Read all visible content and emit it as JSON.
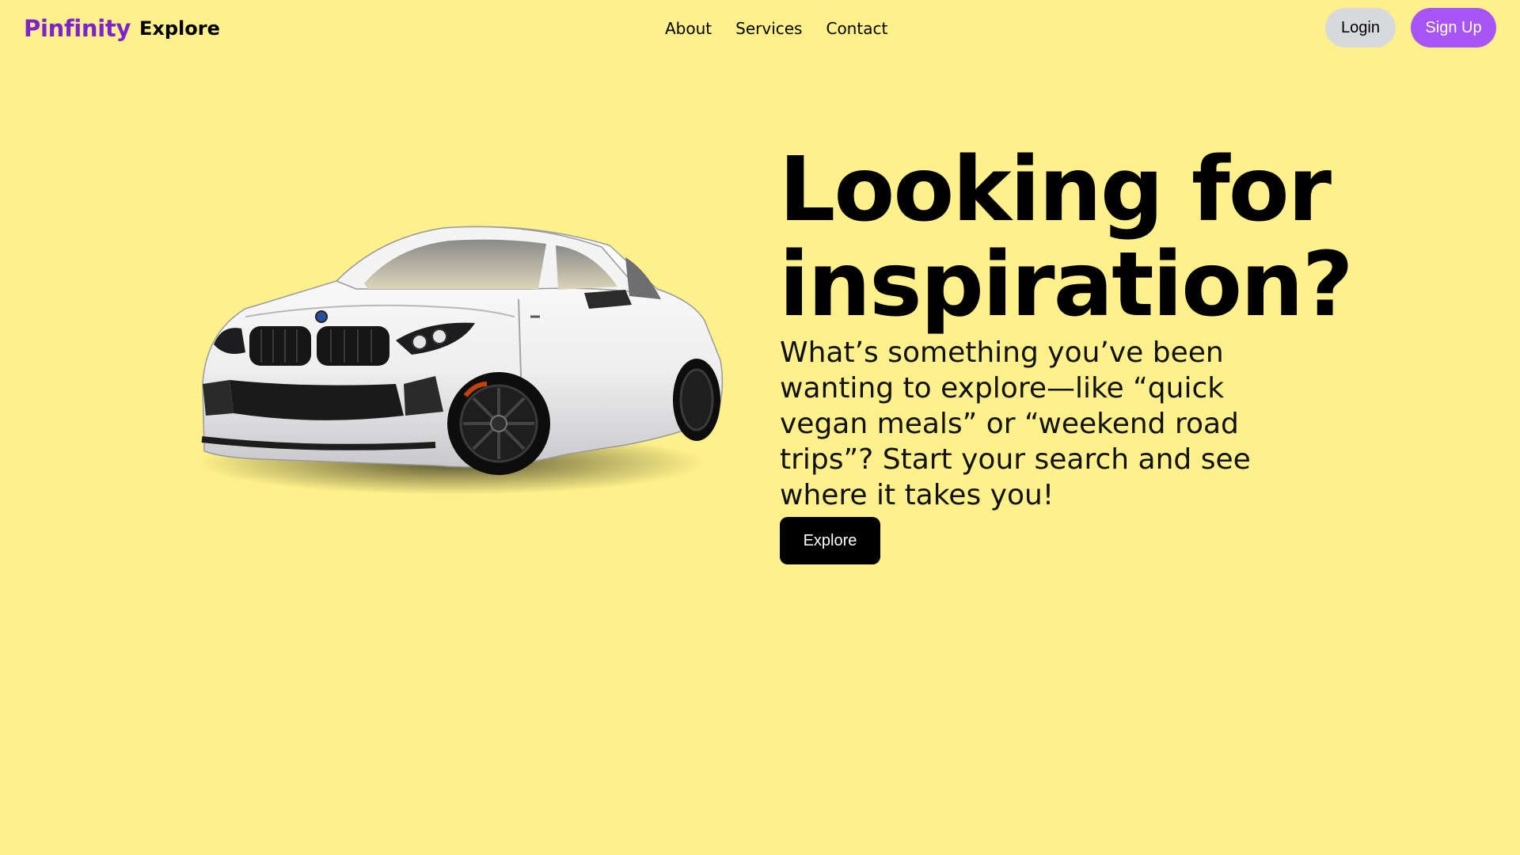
{
  "header": {
    "brand": "Pinfinity",
    "explore": "Explore",
    "nav": [
      "About",
      "Services",
      "Contact"
    ],
    "login_label": "Login",
    "signup_label": "Sign Up"
  },
  "hero": {
    "image": "white sports coupe car photo",
    "title_line1": "Looking for",
    "title_line2": "inspiration?",
    "subtitle": "What’s something you’ve been wanting to explore—like “quick vegan meals” or “weekend road trips”? Start your search and see where it takes you!",
    "cta_label": "Explore"
  },
  "colors": {
    "background": "#fef08a",
    "brand": "#7e22ce",
    "signup": "#a855f7",
    "login": "#d8d9dd",
    "cta": "#000000"
  }
}
